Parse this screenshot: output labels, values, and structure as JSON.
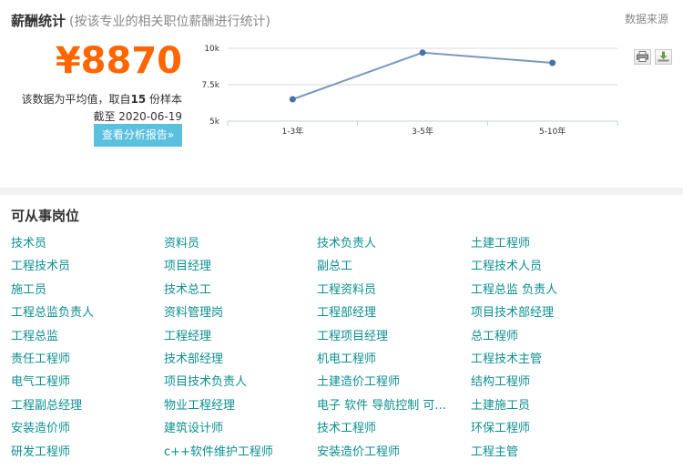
{
  "salary": {
    "title": "薪酬统计",
    "subtitle": "(按该专业的相关职位薪酬进行统计)",
    "data_source": "数据来源",
    "average": "¥8870",
    "note_prefix": "该数据为平均值，取自",
    "note_count": "15",
    "note_suffix": " 份样本",
    "date": "截至 2020-06-19",
    "report_button": "查看分析报告»",
    "print_icon": "print-icon",
    "download_icon": "download-icon"
  },
  "chart_data": {
    "type": "line",
    "categories": [
      "1-3年",
      "3-5年",
      "5-10年"
    ],
    "values": [
      6500,
      9700,
      9000
    ],
    "ylim": [
      5000,
      10000
    ],
    "yticks": [
      "10k",
      "7.5k",
      "5k"
    ],
    "ytick_values": [
      10000,
      7500,
      5000
    ],
    "line_color": "#7a98bf",
    "point_color": "#4572a7",
    "grid": true
  },
  "jobs": {
    "title": "可从事岗位",
    "link_color": "#0e8f8f",
    "rows": [
      [
        "技术员",
        "资料员",
        "技术负责人",
        "土建工程师"
      ],
      [
        "工程技术员",
        "项目经理",
        "副总工",
        "工程技术人员"
      ],
      [
        "施工员",
        "技术总工",
        "工程资料员",
        "工程总监 负责人"
      ],
      [
        "工程总监负责人",
        "资料管理岗",
        "工程部经理",
        "项目技术部经理"
      ],
      [
        "工程总监",
        "工程经理",
        "工程项目经理",
        "总工程师"
      ],
      [
        "责任工程师",
        "技术部经理",
        "机电工程师",
        "工程技术主管"
      ],
      [
        "电气工程师",
        "项目技术负责人",
        "土建造价工程师",
        "结构工程师"
      ],
      [
        "工程副总经理",
        "物业工程经理",
        "电子 软件 导航控制 可...",
        "土建施工员"
      ],
      [
        "安装造价师",
        "建筑设计师",
        "技术工程师",
        "环保工程师"
      ],
      [
        "研发工程师",
        "c++软件维护工程师",
        "安装造价工程师",
        "工程主管"
      ]
    ]
  }
}
